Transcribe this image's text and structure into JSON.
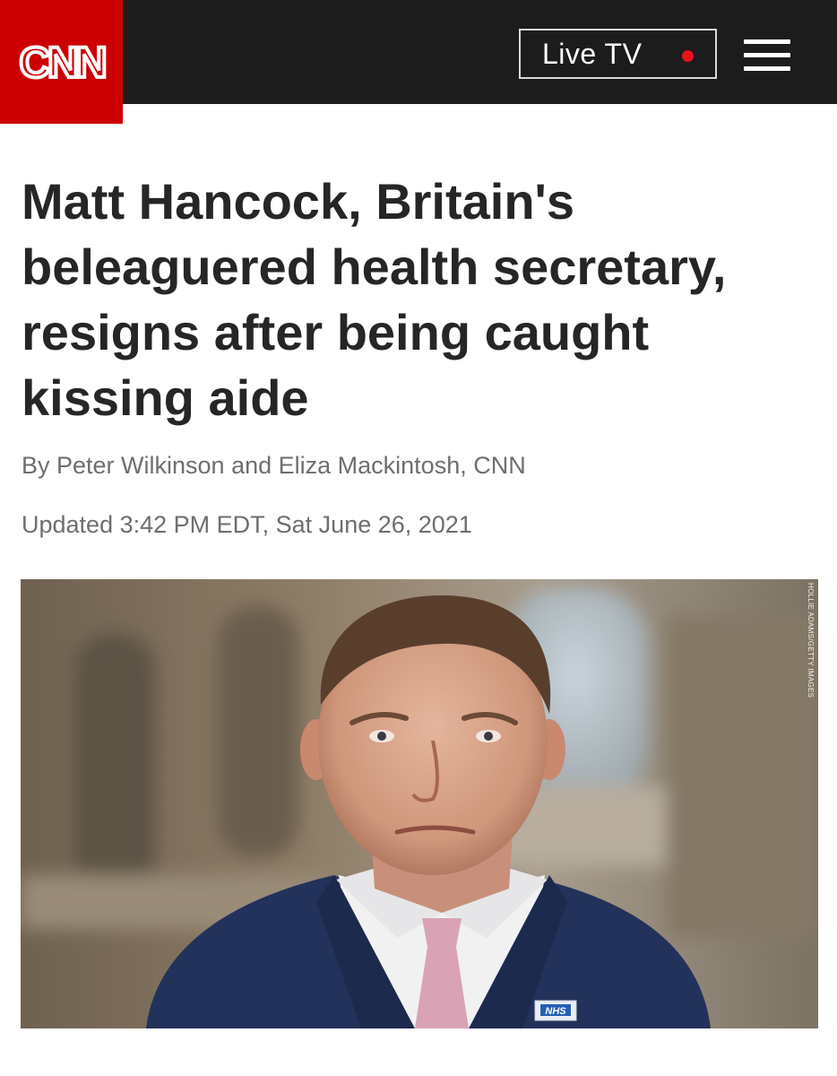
{
  "header": {
    "logo_text": "CNN",
    "live_tv_label": "Live TV",
    "colors": {
      "brand_red": "#cc0000",
      "bar": "#1c1c1c",
      "live_dot": "#e8121c"
    },
    "menu_icon": "hamburger-menu-icon"
  },
  "article": {
    "headline": "Matt Hancock, Britain's beleaguered health secretary, resigns after being caught kissing aide",
    "byline": "By Peter Wilkinson and Eliza Mackintosh, CNN",
    "updated": "Updated 3:42 PM EDT, Sat June 26, 2021",
    "photo_credit": "HOLLIE ADAMS/GETTY IMAGES",
    "photo_badge": "NHS"
  }
}
